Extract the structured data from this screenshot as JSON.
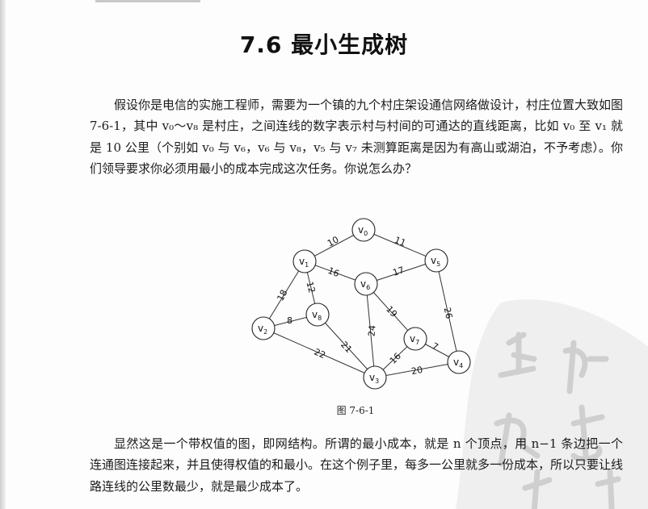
{
  "section_title": "7.6  最小生成树",
  "paragraphs": [
    "假设你是电信的实施工程师，需要为一个镇的九个村庄架设通信网络做设计，村庄位置大致如图 7-6-1，其中 v₀～v₈ 是村庄，之间连线的数字表示村与村间的可通达的直线距离，比如 v₀ 至 v₁ 就是 10 公里（个别如 v₀ 与 v₆，v₆ 与 v₈，v₅ 与 v₇ 未测算距离是因为有高山或湖泊，不予考虑）。你们领导要求你必须用最小的成本完成这次任务。你说怎么办？",
    "显然这是一个带权值的图，即网结构。所谓的最小成本，就是 n 个顶点，用 n−1 条边把一个连通图连接起来，并且使得权值的和最小。在这个例子里，每多一公里就多一份成本，所以只要让线路连线的公里数最少，就是最少成本了。"
  ],
  "figure_caption": "图 7-6-1",
  "graph": {
    "vertices": [
      {
        "id": "v0",
        "label": "v",
        "sub": "0"
      },
      {
        "id": "v1",
        "label": "v",
        "sub": "1"
      },
      {
        "id": "v2",
        "label": "v",
        "sub": "2"
      },
      {
        "id": "v3",
        "label": "v",
        "sub": "3"
      },
      {
        "id": "v4",
        "label": "v",
        "sub": "4"
      },
      {
        "id": "v5",
        "label": "v",
        "sub": "5"
      },
      {
        "id": "v6",
        "label": "v",
        "sub": "6"
      },
      {
        "id": "v7",
        "label": "v",
        "sub": "7"
      },
      {
        "id": "v8",
        "label": "v",
        "sub": "8"
      }
    ],
    "edges": [
      {
        "from": "v0",
        "to": "v1",
        "weight": "10"
      },
      {
        "from": "v0",
        "to": "v5",
        "weight": "11"
      },
      {
        "from": "v1",
        "to": "v6",
        "weight": "16"
      },
      {
        "from": "v5",
        "to": "v6",
        "weight": "17"
      },
      {
        "from": "v1",
        "to": "v2",
        "weight": "18"
      },
      {
        "from": "v1",
        "to": "v8",
        "weight": "12"
      },
      {
        "from": "v2",
        "to": "v8",
        "weight": "8"
      },
      {
        "from": "v6",
        "to": "v7",
        "weight": "19"
      },
      {
        "from": "v5",
        "to": "v4",
        "weight": "26"
      },
      {
        "from": "v6",
        "to": "v3",
        "weight": "24"
      },
      {
        "from": "v8",
        "to": "v3",
        "weight": "21"
      },
      {
        "from": "v2",
        "to": "v3",
        "weight": "22"
      },
      {
        "from": "v7",
        "to": "v3",
        "weight": "16"
      },
      {
        "from": "v7",
        "to": "v4",
        "weight": "7"
      },
      {
        "from": "v3",
        "to": "v4",
        "weight": "20"
      }
    ]
  },
  "watermark": {
    "color": "#c8c8c8"
  }
}
